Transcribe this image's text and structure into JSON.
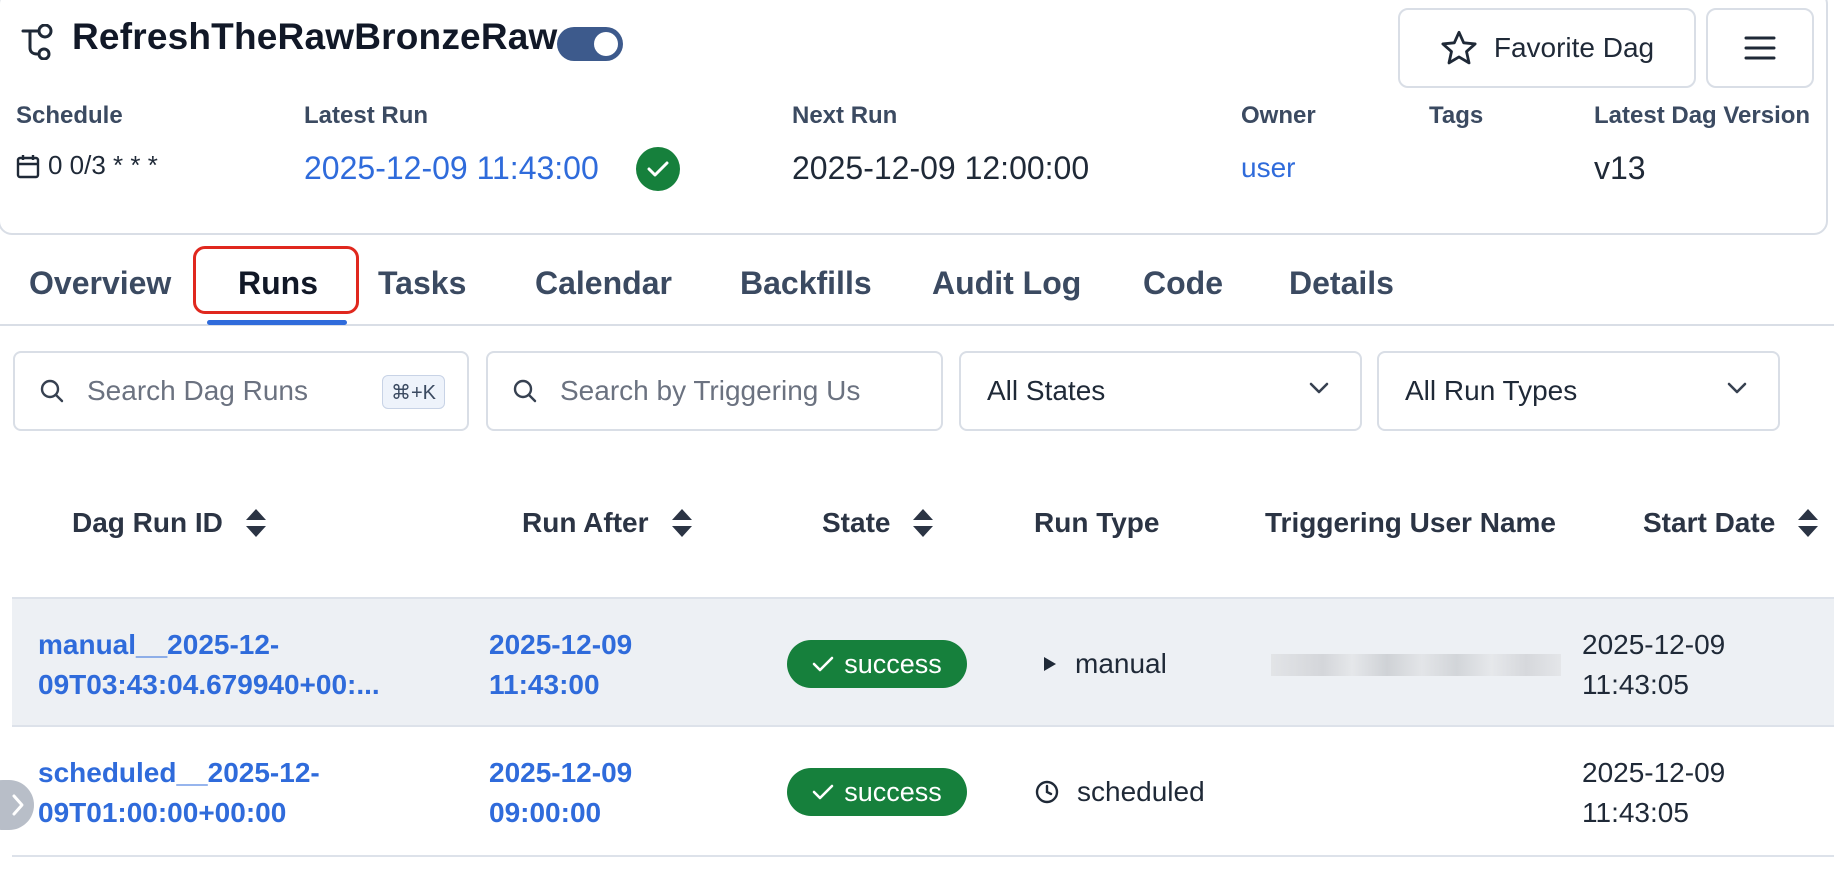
{
  "header": {
    "dag_title": "RefreshTheRawBronzeRaw",
    "favorite_label": "Favorite Dag",
    "schedule": {
      "label": "Schedule",
      "value": "0 0/3 * * *"
    },
    "latest_run": {
      "label": "Latest Run",
      "value": "2025-12-09 11:43:00"
    },
    "next_run": {
      "label": "Next Run",
      "value": "2025-12-09 12:00:00"
    },
    "owner": {
      "label": "Owner",
      "value": "user"
    },
    "tags": {
      "label": "Tags"
    },
    "latest_version": {
      "label": "Latest Dag Version",
      "value": "v13"
    }
  },
  "tabs": [
    {
      "label": "Overview"
    },
    {
      "label": "Runs"
    },
    {
      "label": "Tasks"
    },
    {
      "label": "Calendar"
    },
    {
      "label": "Backfills"
    },
    {
      "label": "Audit Log"
    },
    {
      "label": "Code"
    },
    {
      "label": "Details"
    }
  ],
  "filters": {
    "search_runs_placeholder": "Search Dag Runs",
    "search_shortcut": "⌘+K",
    "search_user_placeholder": "Search by Triggering Us",
    "state_value": "All States",
    "run_type_value": "All Run Types"
  },
  "table": {
    "headers": {
      "run_id": "Dag Run ID",
      "run_after": "Run After",
      "state": "State",
      "run_type": "Run Type",
      "triggering_user": "Triggering User Name",
      "start_date": "Start Date"
    },
    "rows": [
      {
        "run_id_line1": "manual__2025-12-",
        "run_id_line2": "09T03:43:04.679940+00:...",
        "run_after_line1": "2025-12-09",
        "run_after_line2": "11:43:00",
        "state": "success",
        "run_type": "manual",
        "start_line1": "2025-12-09",
        "start_line2": "11:43:05"
      },
      {
        "run_id_line1": "scheduled__2025-12-",
        "run_id_line2": "09T01:00:00+00:00",
        "run_after_line1": "2025-12-09",
        "run_after_line2": "09:00:00",
        "state": "success",
        "run_type": "scheduled",
        "start_line1": "2025-12-09",
        "start_line2": "11:43:05"
      }
    ]
  },
  "colors": {
    "accent": "#2f6bdb",
    "success": "#16803c",
    "highlight": "#e0281e"
  }
}
